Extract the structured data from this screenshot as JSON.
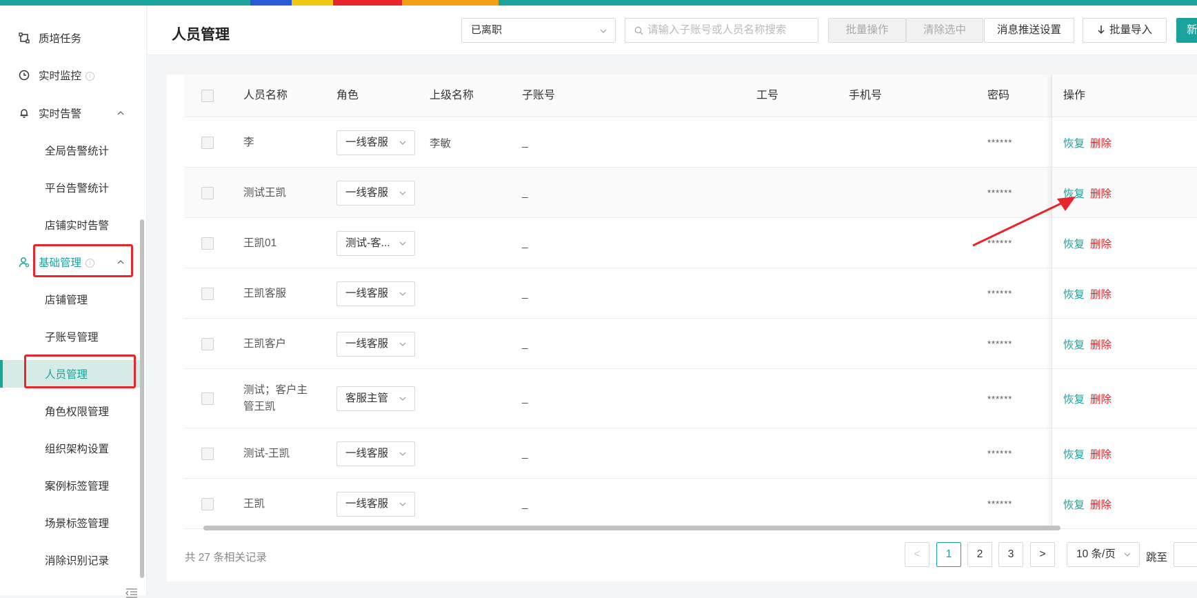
{
  "sidebar": {
    "items": [
      {
        "label": "质培任务",
        "icon": "task-icon"
      },
      {
        "label": "实时监控",
        "icon": "clock-icon"
      },
      {
        "label": "实时告警",
        "icon": "bell-icon"
      },
      {
        "label": "全局告警统计"
      },
      {
        "label": "平台告警统计"
      },
      {
        "label": "店铺实时告警"
      },
      {
        "label": "基础管理",
        "icon": "user-icon"
      },
      {
        "label": "店铺管理"
      },
      {
        "label": "子账号管理"
      },
      {
        "label": "人员管理"
      },
      {
        "label": "角色权限管理"
      },
      {
        "label": "组织架构设置"
      },
      {
        "label": "案例标签管理"
      },
      {
        "label": "场景标签管理"
      },
      {
        "label": "消除识别记录"
      }
    ]
  },
  "header": {
    "title": "人员管理",
    "status_select": "已离职",
    "search_placeholder": "请输入子账号或人员名称搜索",
    "btn_batch_op": "批量操作",
    "btn_clear_sel": "清除选中",
    "btn_msg_push": "消息推送设置",
    "btn_import": "批量导入",
    "btn_new": "新"
  },
  "table": {
    "columns": [
      "人员名称",
      "角色",
      "上级名称",
      "子账号",
      "工号",
      "手机号",
      "密码",
      "操作"
    ],
    "rows": [
      {
        "name": "李",
        "role": "一线客服",
        "superior": "李敏",
        "subaccount": "_",
        "password": "******"
      },
      {
        "name": "测试王凯",
        "role": "一线客服",
        "superior": "",
        "subaccount": "_",
        "password": "******"
      },
      {
        "name": "王凯01",
        "role": "测试-客...",
        "superior": "",
        "subaccount": "_",
        "password": "******"
      },
      {
        "name": "王凯客服",
        "role": "一线客服",
        "superior": "",
        "subaccount": "_",
        "password": "******"
      },
      {
        "name": "王凯客户",
        "role": "一线客服",
        "superior": "",
        "subaccount": "_",
        "password": "******"
      },
      {
        "name": "测试；客户主管王凯",
        "role": "客服主管",
        "superior": "",
        "subaccount": "_",
        "password": "******"
      },
      {
        "name": "测试-王凯",
        "role": "一线客服",
        "superior": "",
        "subaccount": "_",
        "password": "******"
      },
      {
        "name": "王凯",
        "role": "一线客服",
        "superior": "",
        "subaccount": "_",
        "password": "******"
      }
    ],
    "action_restore": "恢复",
    "action_delete": "删除"
  },
  "pagination": {
    "total_text": "共 27 条相关记录",
    "pages": [
      "1",
      "2",
      "3"
    ],
    "current": "1",
    "prev": "<",
    "next": ">",
    "page_size": "10 条/页",
    "jump_label": "跳至"
  },
  "colors": {
    "accent": "#19a39c",
    "danger": "#e8252a",
    "highlight": "#e8252a"
  }
}
